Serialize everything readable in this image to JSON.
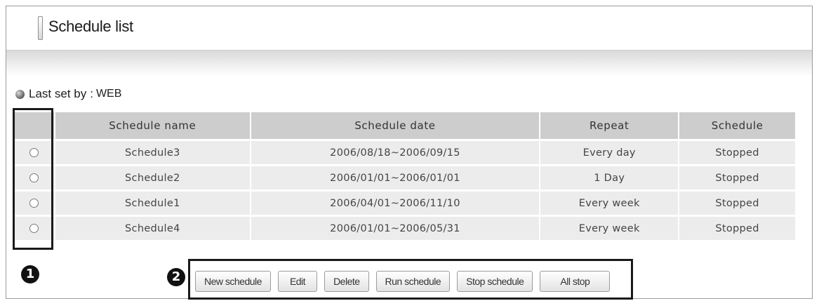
{
  "page": {
    "title": "Schedule list"
  },
  "last_set": {
    "label": "Last set by",
    "separator": ":",
    "value": "WEB"
  },
  "table": {
    "columns": [
      "Schedule name",
      "Schedule date",
      "Repeat",
      "Schedule"
    ],
    "rows": [
      {
        "name": "Schedule3",
        "date": "2006/08/18~2006/09/15",
        "repeat": "Every day",
        "status": "Stopped"
      },
      {
        "name": "Schedule2",
        "date": "2006/01/01~2006/01/01",
        "repeat": "1 Day",
        "status": "Stopped"
      },
      {
        "name": "Schedule1",
        "date": "2006/04/01~2006/11/10",
        "repeat": "Every week",
        "status": "Stopped"
      },
      {
        "name": "Schedule4",
        "date": "2006/01/01~2006/05/31",
        "repeat": "Every week",
        "status": "Stopped"
      }
    ]
  },
  "callouts": {
    "one": "1",
    "two": "2"
  },
  "buttons": {
    "new_schedule": "New schedule",
    "edit": "Edit",
    "delete": "Delete",
    "run_schedule": "Run schedule",
    "stop_schedule": "Stop schedule",
    "all_stop": "All stop"
  }
}
